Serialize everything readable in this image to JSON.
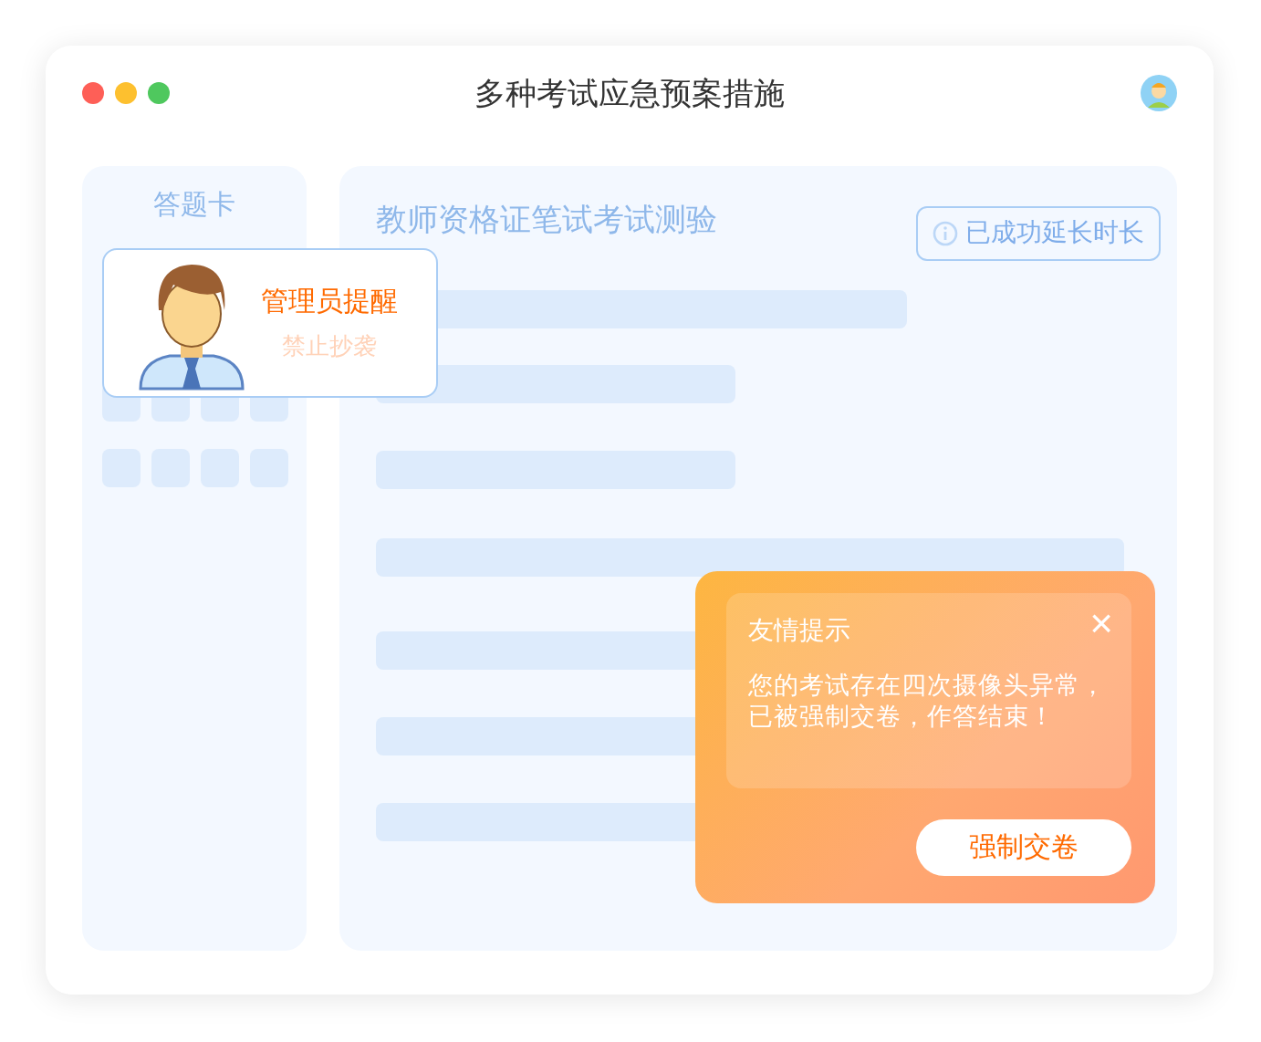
{
  "window": {
    "title": "多种考试应急预案措施"
  },
  "answer_sheet": {
    "title": "答题卡"
  },
  "exam": {
    "title": "教师资格证笔试考试测验",
    "notice": "已成功延长时长"
  },
  "admin_card": {
    "title": "管理员提醒",
    "subtitle": "禁止抄袭"
  },
  "toast": {
    "title": "友情提示",
    "close": "×",
    "message": "您的考试存在四次摄像头异常，已被强制交卷，作答结束！",
    "button": "强制交卷"
  }
}
